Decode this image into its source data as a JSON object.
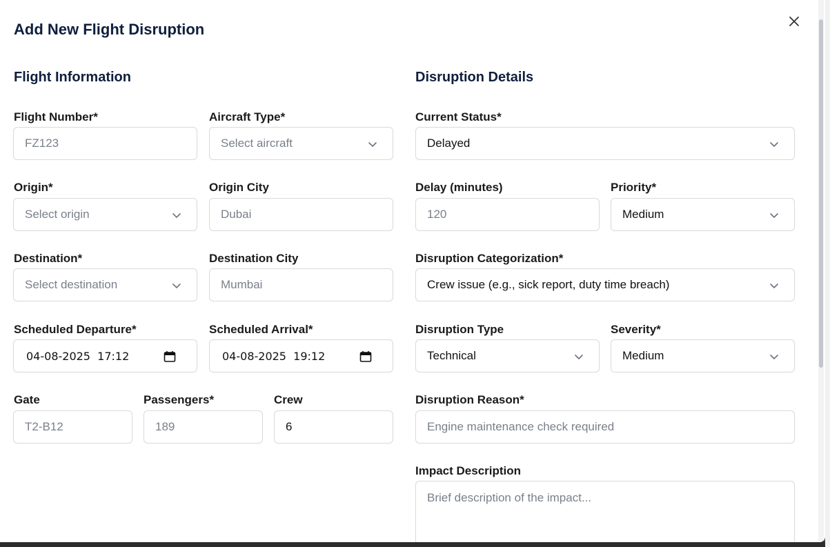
{
  "modal": {
    "title": "Add New Flight Disruption",
    "close_icon": "close-icon"
  },
  "flight_info": {
    "section_title": "Flight Information",
    "flight_number": {
      "label": "Flight Number*",
      "placeholder": "FZ123"
    },
    "aircraft_type": {
      "label": "Aircraft Type*",
      "placeholder": "Select aircraft"
    },
    "origin": {
      "label": "Origin*",
      "placeholder": "Select origin"
    },
    "origin_city": {
      "label": "Origin City",
      "placeholder": "Dubai"
    },
    "destination": {
      "label": "Destination*",
      "placeholder": "Select destination"
    },
    "destination_city": {
      "label": "Destination City",
      "placeholder": "Mumbai"
    },
    "scheduled_departure": {
      "label": "Scheduled Departure*",
      "value": "04-08-2025  17:12"
    },
    "scheduled_arrival": {
      "label": "Scheduled Arrival*",
      "value": "04-08-2025  19:12"
    },
    "gate": {
      "label": "Gate",
      "placeholder": "T2-B12"
    },
    "passengers": {
      "label": "Passengers*",
      "placeholder": "189"
    },
    "crew": {
      "label": "Crew",
      "value": "6"
    }
  },
  "disruption": {
    "section_title": "Disruption Details",
    "current_status": {
      "label": "Current Status*",
      "value": "Delayed"
    },
    "delay_minutes": {
      "label": "Delay (minutes)",
      "placeholder": "120"
    },
    "priority": {
      "label": "Priority*",
      "value": "Medium"
    },
    "categorization": {
      "label": "Disruption Categorization*",
      "value": "Crew issue (e.g., sick report, duty time breach)"
    },
    "type": {
      "label": "Disruption Type",
      "value": "Technical"
    },
    "severity": {
      "label": "Severity*",
      "value": "Medium"
    },
    "reason": {
      "label": "Disruption Reason*",
      "placeholder": "Engine maintenance check required"
    },
    "impact": {
      "label": "Impact Description",
      "placeholder": "Brief description of the impact..."
    }
  }
}
